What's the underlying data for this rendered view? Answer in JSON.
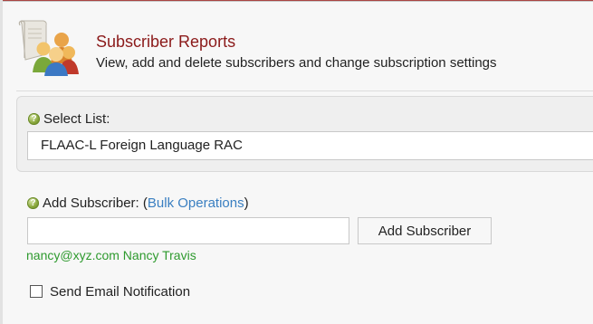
{
  "header": {
    "title": "Subscriber Reports",
    "subtitle": "View, add and delete subscribers and change subscription settings",
    "icon": "subscribers-group-icon"
  },
  "select_list": {
    "label": "Select List:",
    "help_icon": "help-icon",
    "selected_value": "FLAAC-L Foreign Language RAC"
  },
  "add_subscriber": {
    "label_prefix": "Add Subscriber: (",
    "bulk_link": "Bulk Operations",
    "label_suffix": ")",
    "help_icon": "help-icon",
    "input_value": "",
    "input_placeholder": "",
    "button_label": "Add Subscriber",
    "suggestion": "nancy@xyz.com Nancy Travis"
  },
  "notification": {
    "label": "Send Email Notification",
    "checked": false
  },
  "colors": {
    "title": "#8b1a1a",
    "link": "#3a7fc1",
    "suggestion": "#2e9a2e",
    "help_icon": "#8aa83c"
  }
}
